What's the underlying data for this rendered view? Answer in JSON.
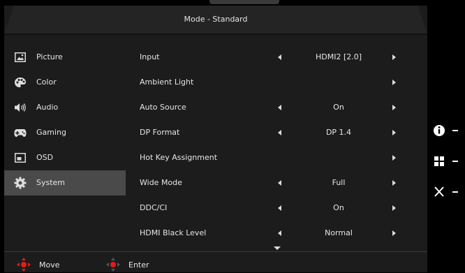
{
  "header": {
    "title": "Mode - Standard"
  },
  "sidebar": {
    "items": [
      {
        "label": "Picture",
        "icon": "picture-icon",
        "active": false
      },
      {
        "label": "Color",
        "icon": "palette-icon",
        "active": false
      },
      {
        "label": "Audio",
        "icon": "speaker-icon",
        "active": false
      },
      {
        "label": "Gaming",
        "icon": "gamepad-icon",
        "active": false
      },
      {
        "label": "OSD",
        "icon": "osd-icon",
        "active": false
      },
      {
        "label": "System",
        "icon": "gear-icon",
        "active": true
      }
    ]
  },
  "settings": [
    {
      "label": "Input",
      "value": "HDMI2 [2.0]"
    },
    {
      "label": "Ambient Light",
      "value": ""
    },
    {
      "label": "Auto Source",
      "value": "On"
    },
    {
      "label": "DP Format",
      "value": "DP 1.4"
    },
    {
      "label": "Hot Key Assignment",
      "value": ""
    },
    {
      "label": "Wide Mode",
      "value": "Full"
    },
    {
      "label": "DDC/CI",
      "value": "On"
    },
    {
      "label": "HDMI Black Level",
      "value": "Normal"
    }
  ],
  "footer": {
    "move_label": "Move",
    "enter_label": "Enter"
  },
  "hotkeys": [
    "info-icon",
    "grid-icon",
    "close-icon"
  ],
  "colors": {
    "background": "#000000",
    "panel": "#1c1c1c",
    "active": "#4a4a4a",
    "accent": "#e01c1c"
  }
}
